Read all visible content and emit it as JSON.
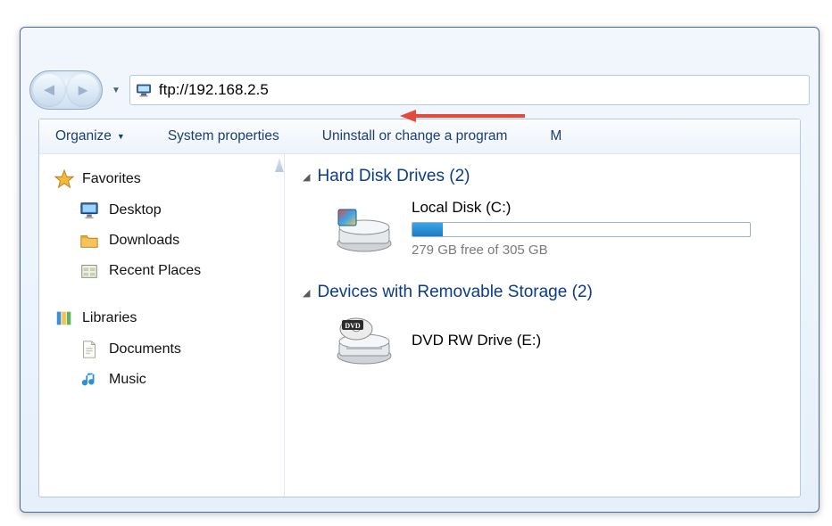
{
  "address": "ftp://192.168.2.5",
  "toolbar": {
    "organize": "Organize",
    "system_properties": "System properties",
    "uninstall": "Uninstall or change a program",
    "more": "M"
  },
  "sidebar": {
    "favorites": "Favorites",
    "desktop": "Desktop",
    "downloads": "Downloads",
    "recent_places": "Recent Places",
    "libraries": "Libraries",
    "documents": "Documents",
    "music": "Music"
  },
  "main": {
    "section1": "Hard Disk Drives (2)",
    "drive1_name": "Local Disk (C:)",
    "drive1_sub": "279 GB free of 305 GB",
    "section2": "Devices with Removable Storage (2)",
    "drive2_name": "DVD RW Drive (E:)"
  }
}
